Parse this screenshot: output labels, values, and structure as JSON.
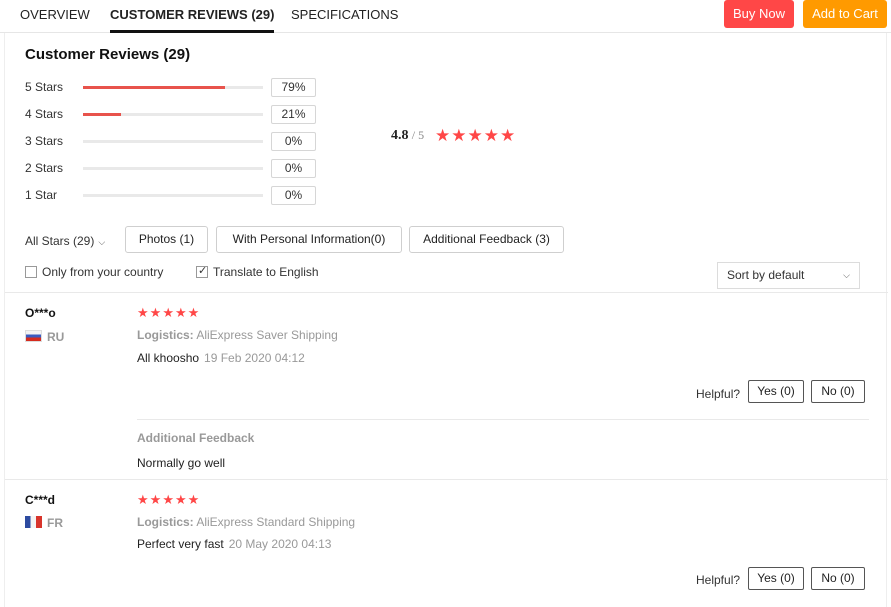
{
  "nav": {
    "tabs": [
      "OVERVIEW",
      "CUSTOMER REVIEWS (29)",
      "SPECIFICATIONS"
    ],
    "buy_now": "Buy Now",
    "add_to_cart": "Add to Cart"
  },
  "summary": {
    "title": "Customer Reviews (29)",
    "rows": [
      {
        "label": "5 Stars",
        "percent": "79%",
        "fraction": 0.79
      },
      {
        "label": "4 Stars",
        "percent": "21%",
        "fraction": 0.21
      },
      {
        "label": "3 Stars",
        "percent": "0%",
        "fraction": 0
      },
      {
        "label": "2 Stars",
        "percent": "0%",
        "fraction": 0
      },
      {
        "label": "1 Star",
        "percent": "0%",
        "fraction": 0
      }
    ],
    "average": "4.8",
    "out_of": "/ 5",
    "star_count": 5
  },
  "filters": {
    "all_stars": "All Stars (29)",
    "photos": "Photos (1)",
    "personal_info": "With Personal Information(0)",
    "additional_feedback": "Additional Feedback (3)",
    "only_country": "Only from your country",
    "only_country_checked": false,
    "translate": "Translate to English",
    "translate_checked": true,
    "sort": "Sort by default"
  },
  "reviews": [
    {
      "name": "O***o",
      "country": "RU",
      "stars": 5,
      "logistics_label": "Logistics:",
      "logistics_value": "AliExpress Saver Shipping",
      "text": "All khoosho",
      "date": "19 Feb 2020 04:12",
      "helpful": "Helpful?",
      "yes": "Yes (0)",
      "no": "No (0)",
      "additional_title": "Additional Feedback",
      "additional_text": "Normally go well"
    },
    {
      "name": "C***d",
      "country": "FR",
      "stars": 5,
      "logistics_label": "Logistics:",
      "logistics_value": "AliExpress Standard Shipping",
      "text": "Perfect very fast",
      "date": "20 May 2020 04:13",
      "helpful": "Helpful?",
      "yes": "Yes (0)",
      "no": "No (0)"
    }
  ],
  "colors": {
    "accent": "#ff4747",
    "cart": "#ff9a00",
    "bar_fill": "#e8534c"
  }
}
